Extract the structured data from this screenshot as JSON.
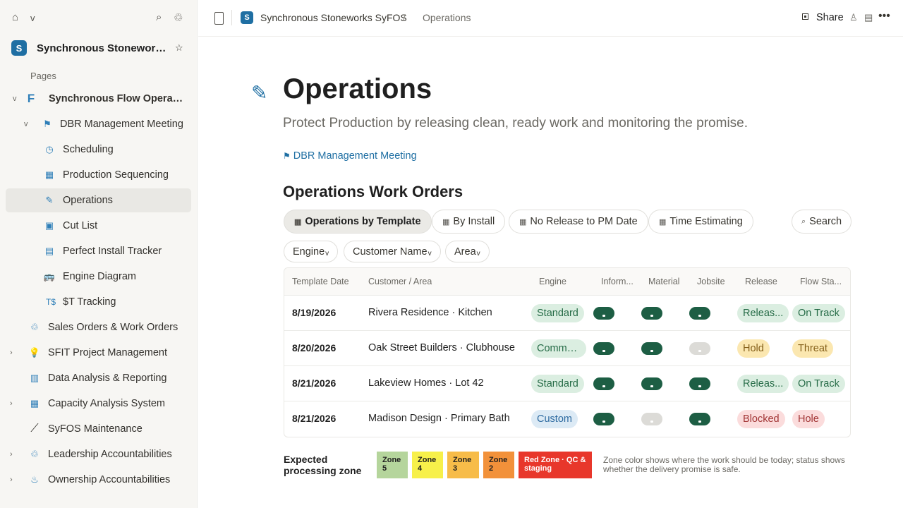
{
  "sidebar": {
    "workspace_name": "Synchronous Stoneworks...",
    "workspace_logo": "S",
    "pages_label": "Pages",
    "items": [
      {
        "label": "Synchronous Flow Operati...",
        "icon": "F",
        "chevron": "v",
        "bold": true
      },
      {
        "label": "DBR Management Meeting",
        "icon": "⚑",
        "chevron": "v"
      },
      {
        "label": "Scheduling",
        "icon": "◷"
      },
      {
        "label": "Production Sequencing",
        "icon": "▦"
      },
      {
        "label": "Operations",
        "icon": "✎",
        "active": true
      },
      {
        "label": "Cut List",
        "icon": "▣"
      },
      {
        "label": "Perfect Install Tracker",
        "icon": "▤"
      },
      {
        "label": "Engine Diagram",
        "icon": "🚌"
      },
      {
        "label": "$T Tracking",
        "icon": "T$"
      },
      {
        "label": "Sales Orders & Work Orders",
        "icon": "♲"
      },
      {
        "label": "SFIT Project Management",
        "icon": "💡",
        "chevron": "›"
      },
      {
        "label": "Data Analysis & Reporting",
        "icon": "▥"
      },
      {
        "label": "Capacity Analysis System",
        "icon": "▦",
        "chevron": "›"
      },
      {
        "label": "SyFOS Maintenance",
        "icon": "⟋"
      },
      {
        "label": "Leadership Accountabilities",
        "icon": "♲",
        "chevron": "›"
      },
      {
        "label": "Ownership Accountabilities",
        "icon": "♨",
        "chevron": "›"
      }
    ]
  },
  "topbar": {
    "logo": "S",
    "workspace": "Synchronous Stoneworks SyFOS",
    "separator": "/",
    "page": "Operations",
    "share": "Share"
  },
  "page": {
    "icon": "✎",
    "title": "Operations",
    "subtitle": "Protect Production by releasing clean, ready work and monitoring the promise.",
    "link_icon": "⚑",
    "link": "DBR Management Meeting",
    "section_title": "Operations Work Orders"
  },
  "views": [
    {
      "label": "Operations by Template",
      "active": true
    },
    {
      "label": "By Install"
    },
    {
      "label": "No Release to PM Date"
    },
    {
      "label": "Time Estimating"
    }
  ],
  "search": {
    "label": "Search"
  },
  "filters": [
    "Engine",
    "Customer Name",
    "Area"
  ],
  "table": {
    "headers": [
      "Template Date",
      "Customer / Area",
      "Engine",
      "Inform...",
      "Material",
      "Jobsite",
      "Release",
      "Flow Sta..."
    ],
    "rows": [
      {
        "date": "8/19/2026",
        "customer": "Rivera Residence · Kitchen",
        "engine": "Standard",
        "engine_color": "green",
        "inform": true,
        "material": true,
        "jobsite": true,
        "release": "Releas...",
        "release_color": "green",
        "flow": "On Track",
        "flow_color": "green"
      },
      {
        "date": "8/20/2026",
        "customer": "Oak Street Builders · Clubhouse",
        "engine": "Commer...",
        "engine_color": "green",
        "inform": true,
        "material": true,
        "jobsite": false,
        "release": "Hold",
        "release_color": "yellow",
        "flow": "Threat",
        "flow_color": "yellow"
      },
      {
        "date": "8/21/2026",
        "customer": "Lakeview Homes · Lot 42",
        "engine": "Standard",
        "engine_color": "green",
        "inform": true,
        "material": true,
        "jobsite": true,
        "release": "Releas...",
        "release_color": "green",
        "flow": "On Track",
        "flow_color": "green"
      },
      {
        "date": "8/21/2026",
        "customer": "Madison Design · Primary Bath",
        "engine": "Custom",
        "engine_color": "blue",
        "inform": true,
        "material": false,
        "jobsite": true,
        "release": "Blocked",
        "release_color": "red",
        "flow": "Hole",
        "flow_color": "red"
      }
    ]
  },
  "legend": {
    "label": "Expected processing zone",
    "zones": [
      {
        "label": "Zone 5",
        "bg": "#b5d59c",
        "fg": "#1f1f1f"
      },
      {
        "label": "Zone 4",
        "bg": "#f7f04a",
        "fg": "#1f1f1f"
      },
      {
        "label": "Zone 3",
        "bg": "#f7bc49",
        "fg": "#1f1f1f"
      },
      {
        "label": "Zone 2",
        "bg": "#f2913a",
        "fg": "#1f1f1f"
      },
      {
        "label": "Red Zone · QC & staging",
        "bg": "#e8372b",
        "fg": "#ffffff"
      }
    ],
    "note": "Zone color shows where the work should be today; status shows whether the delivery promise is safe."
  },
  "colors": {
    "accent": "#1f6fa3",
    "toggle_on": "#1d5e44"
  }
}
